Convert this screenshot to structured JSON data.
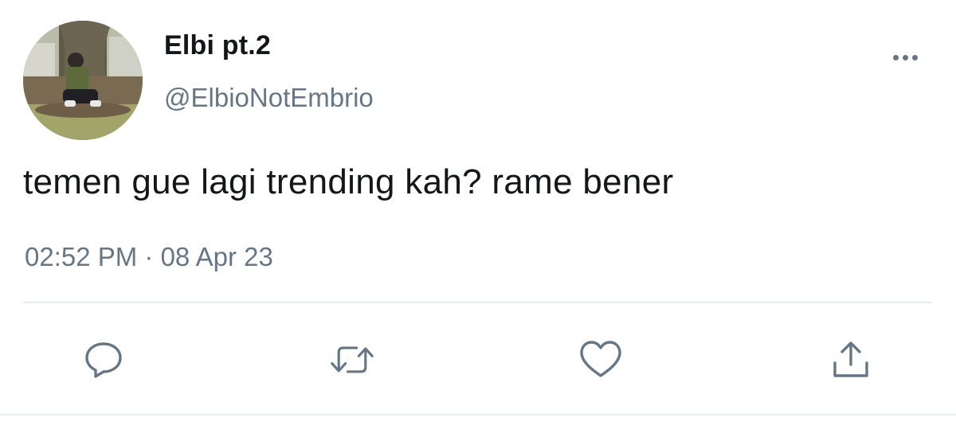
{
  "tweet": {
    "display_name": "Elbi pt.2",
    "handle": "@ElbioNotEmbrio",
    "text": "temen gue lagi trending kah? rame bener",
    "time": "02:52 PM",
    "separator": " · ",
    "date": "08 Apr 23"
  },
  "icons": {
    "more": "more-options-icon",
    "reply": "reply-icon",
    "retweet": "retweet-icon",
    "like": "heart-icon",
    "share": "share-icon"
  },
  "colors": {
    "text_primary": "#14171a",
    "text_secondary": "#657786",
    "divider": "#e6ecf0"
  }
}
